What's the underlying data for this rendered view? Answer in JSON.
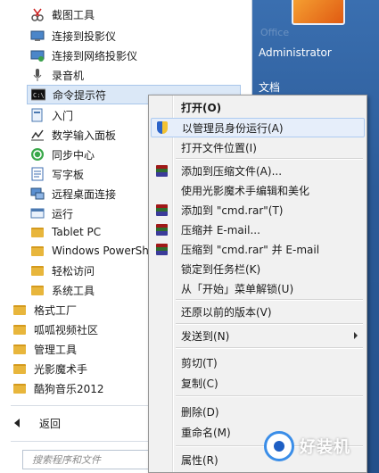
{
  "program_list": [
    {
      "label": "截图工具",
      "icon": "scissors-icon"
    },
    {
      "label": "连接到投影仪",
      "icon": "projector-icon"
    },
    {
      "label": "连接到网络投影仪",
      "icon": "network-projector-icon"
    },
    {
      "label": "录音机",
      "icon": "microphone-icon"
    },
    {
      "label": "命令提示符",
      "icon": "cmd-icon"
    },
    {
      "label": "入门",
      "icon": "getting-started-icon"
    },
    {
      "label": "数学输入面板",
      "icon": "math-input-icon"
    },
    {
      "label": "同步中心",
      "icon": "sync-icon"
    },
    {
      "label": "写字板",
      "icon": "wordpad-icon"
    },
    {
      "label": "远程桌面连接",
      "icon": "remote-desktop-icon"
    },
    {
      "label": "运行",
      "icon": "run-icon"
    },
    {
      "label": "Tablet PC",
      "icon": "folder-icon"
    },
    {
      "label": "Windows PowerSh",
      "icon": "folder-icon"
    },
    {
      "label": "轻松访问",
      "icon": "folder-icon"
    },
    {
      "label": "系统工具",
      "icon": "folder-icon"
    },
    {
      "label": "格式工厂",
      "icon": "folder-icon"
    },
    {
      "label": "呱呱视频社区",
      "icon": "folder-icon"
    },
    {
      "label": "管理工具",
      "icon": "folder-icon"
    },
    {
      "label": "光影魔术手",
      "icon": "folder-icon"
    },
    {
      "label": "酷狗音乐2012",
      "icon": "folder-icon"
    }
  ],
  "back_label": "返回",
  "search": {
    "placeholder": "搜索程序和文件"
  },
  "right_pane": {
    "user_name": "Administrator",
    "documents": "文档"
  },
  "context_menu": [
    {
      "label": "打开(O)",
      "bold": true
    },
    {
      "label": "以管理员身份运行(A)",
      "icon": "uac-shield-icon",
      "highlighted": true
    },
    {
      "label": "打开文件位置(I)"
    },
    {
      "label": "添加到压缩文件(A)...",
      "icon": "winrar-icon"
    },
    {
      "label": "使用光影魔术手编辑和美化"
    },
    {
      "label": "添加到 \"cmd.rar\"(T)",
      "icon": "winrar-icon"
    },
    {
      "label": "压缩并 E-mail...",
      "icon": "winrar-icon"
    },
    {
      "label": "压缩到 \"cmd.rar\" 并 E-mail",
      "icon": "winrar-icon"
    },
    {
      "label": "锁定到任务栏(K)"
    },
    {
      "label": "从「开始」菜单解锁(U)"
    },
    {
      "label": "还原以前的版本(V)"
    },
    {
      "label": "发送到(N)",
      "submenu": true
    },
    {
      "label": "剪切(T)"
    },
    {
      "label": "复制(C)"
    },
    {
      "label": "删除(D)"
    },
    {
      "label": "重命名(M)"
    },
    {
      "label": "属性(R)"
    }
  ],
  "watermark": {
    "text": "好装机"
  },
  "colors": {
    "accent": "#2c5b98",
    "highlight": "#dbe8f7"
  }
}
